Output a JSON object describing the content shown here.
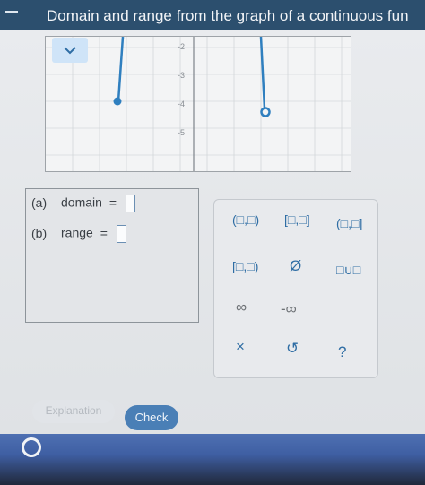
{
  "title": "Domain and range from the graph of a continuous fun",
  "graph": {
    "y_tick_labels": [
      "-2",
      "-3",
      "-4",
      "-5"
    ]
  },
  "inputs": {
    "a_label": "(a)",
    "domain_label": "domain",
    "b_label": "(b)",
    "range_label": "range",
    "equals": "="
  },
  "palette": {
    "closed_closed": "[□,□]",
    "open_closed": "(□,□]",
    "closed_open": "[□,□)",
    "open_open": "(□,□)",
    "empty_set": "Ø",
    "union": "□∪□",
    "infinity": "∞",
    "neg_infinity": "-∞",
    "clear": "×",
    "undo": "↺",
    "help": "?"
  },
  "buttons": {
    "explanation": "Explanation",
    "check": "Check"
  },
  "colors": {
    "title_bar": "#2c4f6e",
    "accent": "#2e6da4",
    "graph_line": "#2f7fbf"
  }
}
